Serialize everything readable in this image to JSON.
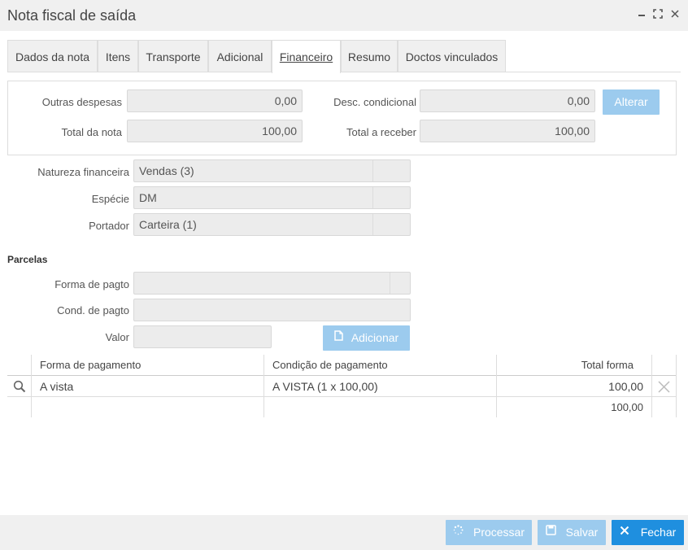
{
  "window": {
    "title": "Nota fiscal de saída"
  },
  "tabs": [
    {
      "label": "Dados da nota"
    },
    {
      "label": "Itens"
    },
    {
      "label": "Transporte"
    },
    {
      "label": "Adicional"
    },
    {
      "label": "Financeiro"
    },
    {
      "label": "Resumo"
    },
    {
      "label": "Doctos vinculados"
    }
  ],
  "totals": {
    "outras_despesas_label": "Outras despesas",
    "outras_despesas_value": "0,00",
    "desc_condicional_label": "Desc. condicional",
    "desc_condicional_value": "0,00",
    "alterar_label": "Alterar",
    "total_nota_label": "Total da nota",
    "total_nota_value": "100,00",
    "total_receber_label": "Total a receber",
    "total_receber_value": "100,00"
  },
  "financeiro": {
    "natureza_label": "Natureza financeira",
    "natureza_value": "Vendas (3)",
    "especie_label": "Espécie",
    "especie_value": "DM",
    "portador_label": "Portador",
    "portador_value": "Carteira (1)"
  },
  "parcelas": {
    "title": "Parcelas",
    "forma_label": "Forma de pagto",
    "forma_value": "",
    "cond_label": "Cond. de pagto",
    "cond_value": "",
    "valor_label": "Valor",
    "valor_value": "",
    "adicionar_label": "Adicionar"
  },
  "grid": {
    "headers": [
      "Forma de pagamento",
      "Condição de pagamento",
      "Total forma"
    ],
    "rows": [
      {
        "forma": "A vista",
        "condicao": "A VISTA (1 x 100,00)",
        "total": "100,00"
      }
    ],
    "footer_total": "100,00"
  },
  "footer": {
    "processar_label": "Processar",
    "salvar_label": "Salvar",
    "fechar_label": "Fechar"
  },
  "colors": {
    "primary": "#1f8fdf",
    "primary_disabled": "#9ccbee",
    "field_bg": "#ececec"
  }
}
